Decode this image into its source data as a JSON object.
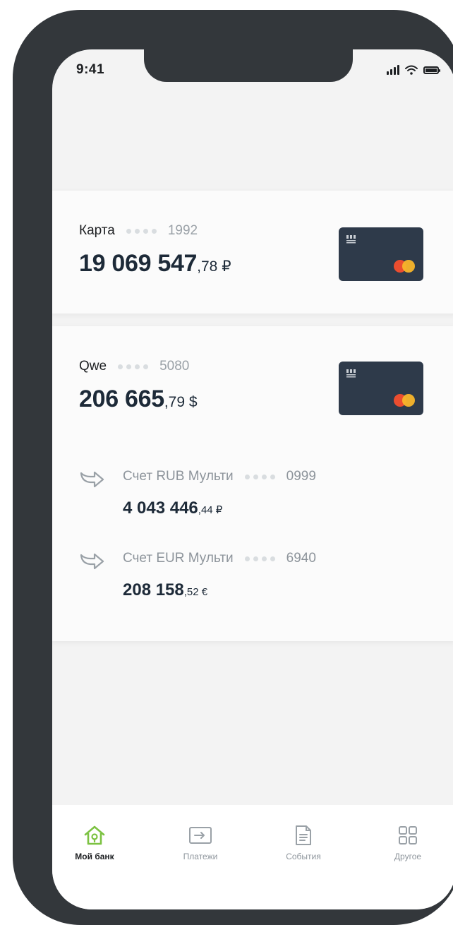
{
  "status_bar": {
    "time": "9:41"
  },
  "accounts": [
    {
      "label": "Карта",
      "number": "1992",
      "balance_main": "19 069 547",
      "balance_cents": ",78 ₽"
    },
    {
      "label": "Qwe",
      "number": "5080",
      "balance_main": "206 665",
      "balance_cents": ",79 $",
      "sub_accounts": [
        {
          "label": "Счет RUB Мульти",
          "number": "0999",
          "balance_main": "4 043 446",
          "balance_cents": ",44 ₽"
        },
        {
          "label": "Счет EUR Мульти",
          "number": "6940",
          "balance_main": "208 158",
          "balance_cents": ",52 €"
        }
      ]
    }
  ],
  "tab_bar": {
    "items": [
      {
        "label": "Мой банк",
        "icon": "home-icon",
        "active": true
      },
      {
        "label": "Платежи",
        "icon": "payments-icon",
        "active": false
      },
      {
        "label": "События",
        "icon": "document-icon",
        "active": false
      },
      {
        "label": "Другое",
        "icon": "grid-icon",
        "active": false
      }
    ]
  },
  "colors": {
    "frame": "#33373b",
    "screen_bg": "#f3f3f3",
    "card_bg": "#2e3a4a",
    "accent_green": "#7cc242",
    "balance_text": "#1d2a38"
  }
}
